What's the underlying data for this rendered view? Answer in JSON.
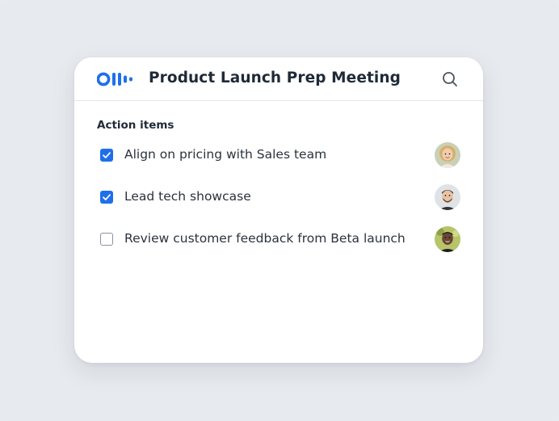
{
  "app": {
    "logo_icon": "otter-logo-icon",
    "title": "Product Launch Prep Meeting",
    "search_icon": "search-icon"
  },
  "action_items": {
    "heading": "Action items",
    "items": [
      {
        "label": "Align on pricing with Sales team",
        "checked": true,
        "avatar": "avatar-woman-blonde"
      },
      {
        "label": "Lead tech showcase",
        "checked": true,
        "avatar": "avatar-man-beard"
      },
      {
        "label": "Review customer feedback from Beta launch",
        "checked": false,
        "avatar": "avatar-man-dark"
      }
    ]
  },
  "colors": {
    "accent": "#1f6feb",
    "background": "#e7eaee",
    "card": "#ffffff",
    "text": "#1f2a37"
  }
}
